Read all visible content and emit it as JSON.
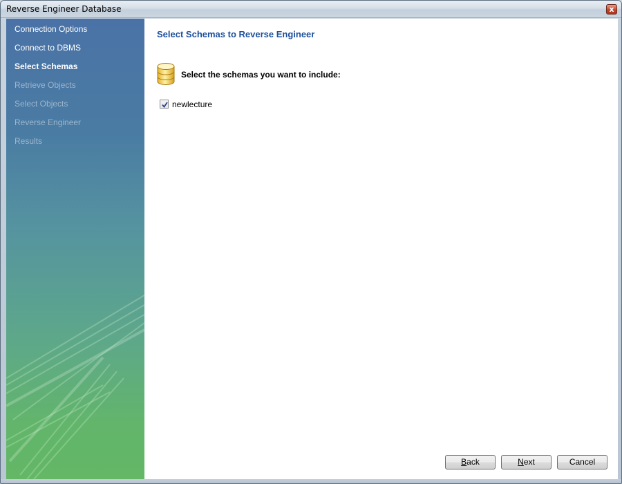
{
  "window": {
    "title": "Reverse Engineer Database",
    "close_glyph": "x"
  },
  "sidebar": {
    "steps": [
      {
        "label": "Connection Options",
        "state": "done"
      },
      {
        "label": "Connect to DBMS",
        "state": "done"
      },
      {
        "label": "Select Schemas",
        "state": "current"
      },
      {
        "label": "Retrieve Objects",
        "state": "pending"
      },
      {
        "label": "Select Objects",
        "state": "pending"
      },
      {
        "label": "Reverse Engineer",
        "state": "pending"
      },
      {
        "label": "Results",
        "state": "pending"
      }
    ]
  },
  "main": {
    "title": "Select Schemas to Reverse Engineer",
    "icon": "database-icon",
    "prompt": "Select the schemas you want to include:",
    "schemas": [
      {
        "name": "newlecture",
        "checked": true
      }
    ]
  },
  "buttons": {
    "back": {
      "accel": "B",
      "rest": "ack"
    },
    "next": {
      "accel": "N",
      "rest": "ext"
    },
    "cancel": "Cancel"
  },
  "colors": {
    "title_blue": "#1d4f9c",
    "sidebar_top": "#4a72a6",
    "sidebar_bottom": "#63b765",
    "pending_text": "#9db6cc"
  }
}
